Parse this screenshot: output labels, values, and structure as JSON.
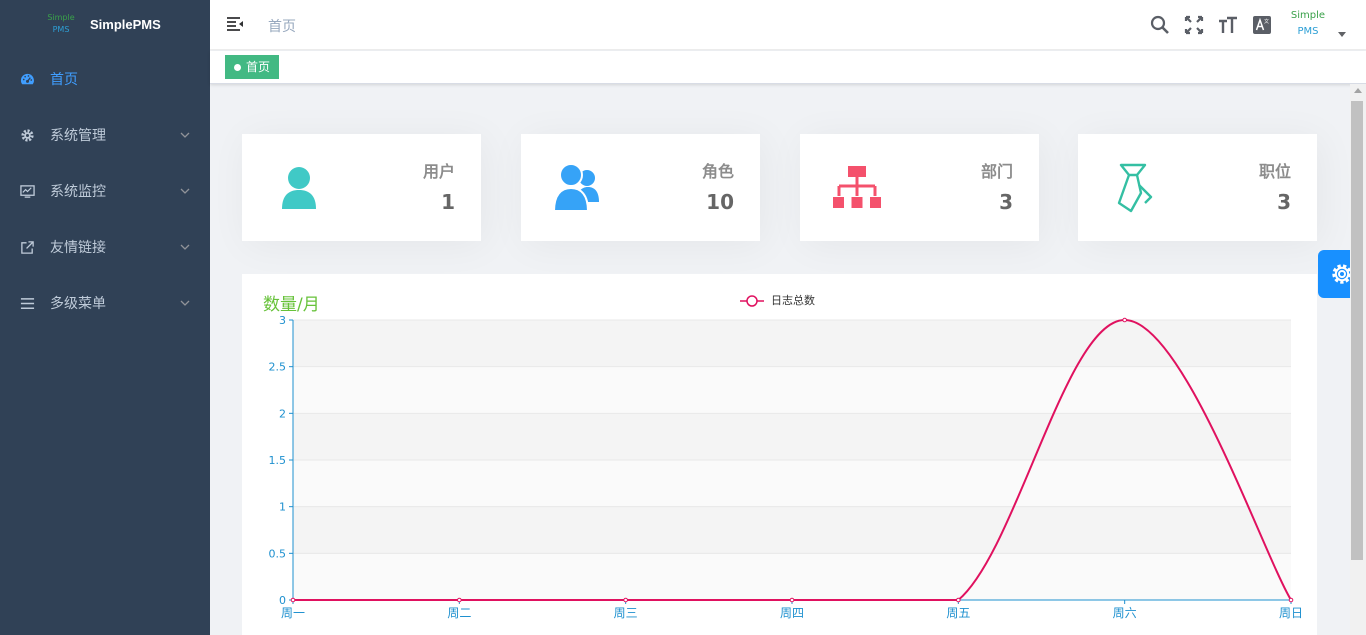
{
  "logo": {
    "mark_line1": "Simple",
    "mark_line2": "PMS",
    "title": "SimplePMS"
  },
  "sidebar": {
    "items": [
      {
        "label": "首页",
        "icon": "dashboard-icon",
        "active": true
      },
      {
        "label": "系统管理",
        "icon": "gear-icon",
        "active": false
      },
      {
        "label": "系统监控",
        "icon": "monitor-icon",
        "active": false
      },
      {
        "label": "友情链接",
        "icon": "external-link-icon",
        "active": false
      },
      {
        "label": "多级菜单",
        "icon": "list-icon",
        "active": false
      }
    ]
  },
  "navbar": {
    "breadcrumb": "首页",
    "icons": [
      "search-icon",
      "fullscreen-icon",
      "font-size-icon",
      "language-icon"
    ],
    "avatar_line1": "Simple",
    "avatar_line2": "PMS"
  },
  "tags": [
    {
      "label": "首页",
      "active": true
    }
  ],
  "cards": [
    {
      "label": "用户",
      "value": "1",
      "icon": "user-icon",
      "color": "#40c9c6"
    },
    {
      "label": "角色",
      "value": "10",
      "icon": "users-icon",
      "color": "#36a3f7"
    },
    {
      "label": "部门",
      "value": "3",
      "icon": "org-tree-icon",
      "color": "#f4516c"
    },
    {
      "label": "职位",
      "value": "3",
      "icon": "tie-icon",
      "color": "#34bfa3"
    }
  ],
  "colors": {
    "sidebar_bg": "#304156",
    "accent": "#409eff",
    "tag": "#42b983",
    "line": "#e0115f",
    "axis": "#1e90cf",
    "chart_title": "#67c23a"
  },
  "chart_data": {
    "type": "line",
    "title": "数量/月",
    "categories": [
      "周一",
      "周二",
      "周三",
      "周四",
      "周五",
      "周六",
      "周日"
    ],
    "series": [
      {
        "name": "日志总数",
        "values": [
          0,
          0,
          0,
          0,
          0,
          3,
          0
        ]
      }
    ],
    "ylim": [
      0,
      3
    ],
    "yticks": [
      "0",
      "0.5",
      "1",
      "1.5",
      "2",
      "2.5",
      "3"
    ],
    "legend": "top-center",
    "smooth": true
  }
}
